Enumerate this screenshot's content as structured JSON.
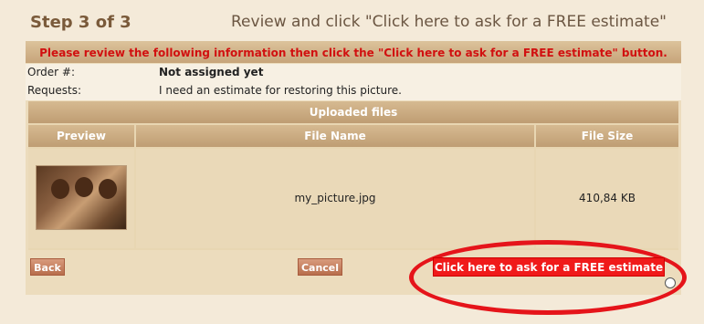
{
  "header": {
    "step": "Step 3 of 3",
    "instruction": "Review and click \"Click here to ask for a FREE estimate\""
  },
  "notice": "Please review the following information then click the \"Click here to ask for a FREE estimate\" button.",
  "order": {
    "label": "Order #:",
    "value": "Not assigned yet"
  },
  "requests": {
    "label": "Requests:",
    "value": "I need an estimate for restoring this picture."
  },
  "files": {
    "title": "Uploaded files",
    "columns": [
      "Preview",
      "File Name",
      "File Size"
    ],
    "rows": [
      {
        "file_name": "my_picture.jpg",
        "file_size": "410,84 KB",
        "preview_icon": "photo-thumbnail"
      }
    ]
  },
  "buttons": {
    "back": "Back",
    "cancel": "Cancel",
    "free_estimate": "Click here to ask for a FREE estimate"
  },
  "colors": {
    "accent_red": "#f01a1a",
    "highlight_ring": "#e5141a",
    "header_brown": "#7a5a3a"
  }
}
